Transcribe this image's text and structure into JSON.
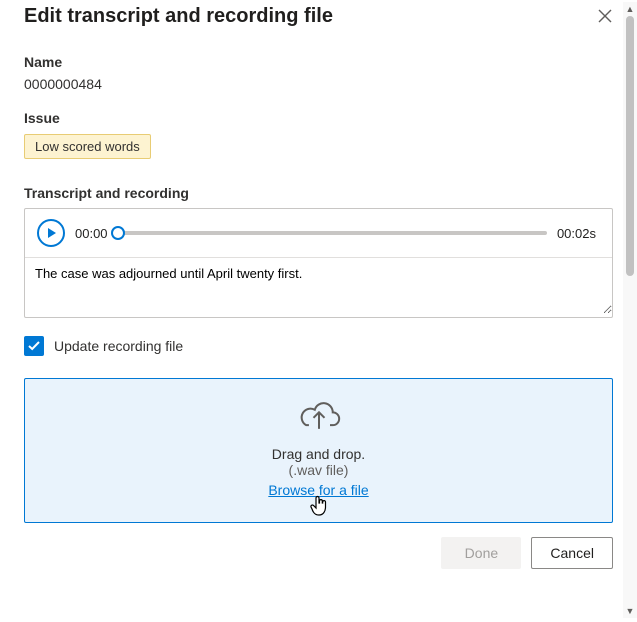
{
  "dialog": {
    "title": "Edit transcript and recording file"
  },
  "name": {
    "label": "Name",
    "value": "0000000484"
  },
  "issue": {
    "label": "Issue",
    "badge": "Low scored words"
  },
  "transcript": {
    "label": "Transcript and recording",
    "current_time": "00:00",
    "total_time": "00:02s",
    "text": "The case was adjourned until April twenty first."
  },
  "update_checkbox": {
    "checked": true,
    "label": "Update recording file"
  },
  "dropzone": {
    "primary": "Drag and drop.",
    "secondary": "(.wav file)",
    "browse": "Browse for a file"
  },
  "footer": {
    "done": "Done",
    "cancel": "Cancel"
  }
}
